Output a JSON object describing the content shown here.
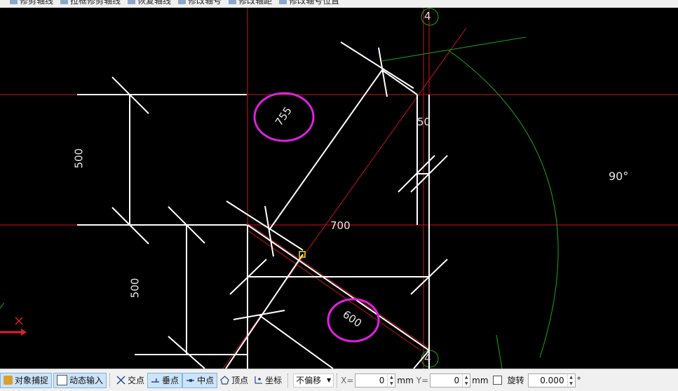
{
  "toolbar_top": {
    "items": [
      "修剪轴线",
      "拉框修剪轴线",
      "恢复轴线",
      "修改轴号",
      "修改轴距",
      "修改轴号位置"
    ]
  },
  "canvas": {
    "axis_label_top": "4",
    "axis_label_bottom": "4",
    "dimensions": {
      "d500_upper": "500",
      "d500_lower": "500",
      "d755": "755",
      "d50": "50",
      "d700": "700",
      "d600": "600",
      "angle": "90°"
    },
    "colors": {
      "background": "#000000",
      "axis_line": "#c8141e",
      "wall": "#ffffff",
      "arc": "#1aa51a",
      "highlight_circle": "#e020e0",
      "snap_point": "#e8e800"
    }
  },
  "statusbar": {
    "object_snap": "对象捕捉",
    "dynamic_input": "动态输入",
    "intersection": "交点",
    "perpendicular": "垂点",
    "midpoint": "中点",
    "vertex": "顶点",
    "coordinate": "坐标",
    "offset_value": "不偏移",
    "x_label": "X=",
    "x_value": "0",
    "x_unit": "mm",
    "y_label": "Y=",
    "y_value": "0",
    "y_unit": "mm",
    "rotate_label": "旋转",
    "rotate_value": "0.000",
    "degree_symbol": "°"
  }
}
